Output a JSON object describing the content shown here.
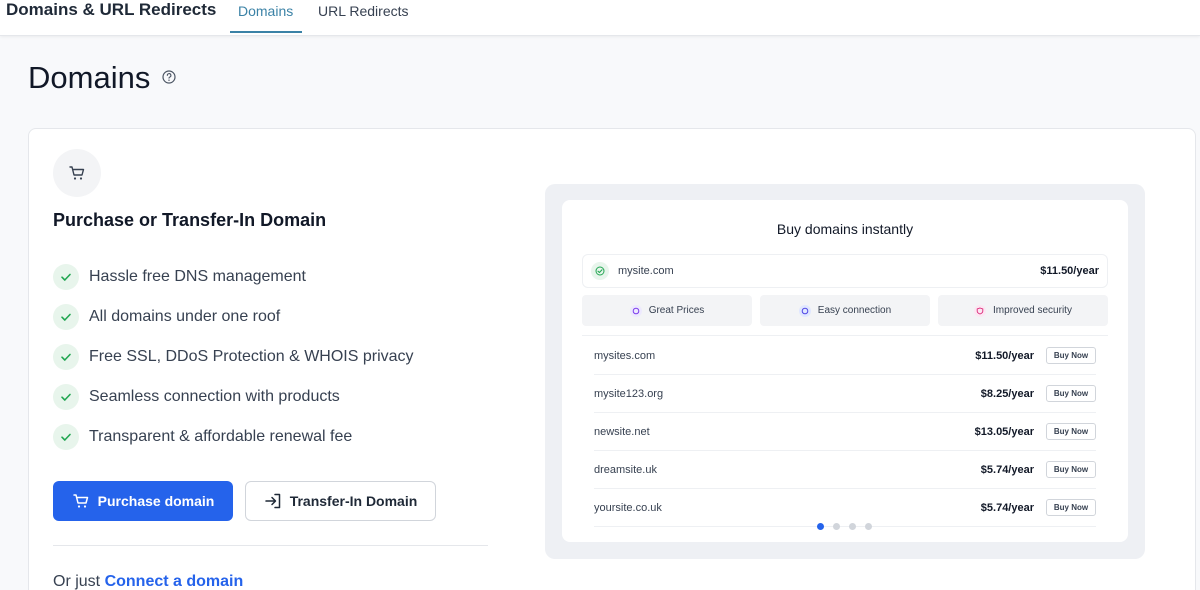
{
  "header": {
    "app_title": "Domains & URL Redirects",
    "tabs": [
      {
        "label": "Domains",
        "active": true
      },
      {
        "label": "URL Redirects",
        "active": false
      }
    ]
  },
  "page": {
    "title": "Domains"
  },
  "purchase": {
    "title": "Purchase or Transfer-In Domain",
    "features": [
      "Hassle free DNS management",
      "All domains under one roof",
      "Free SSL, DDoS Protection & WHOIS privacy",
      "Seamless connection with products",
      "Transparent & affordable renewal fee"
    ],
    "purchase_button": "Purchase domain",
    "transfer_button": "Transfer-In Domain",
    "connect_prefix": "Or just ",
    "connect_link": "Connect a domain"
  },
  "preview": {
    "title": "Buy domains instantly",
    "selected": {
      "domain": "mysite.com",
      "price": "$11.50/year"
    },
    "pills": [
      "Great Prices",
      "Easy connection",
      "Improved security"
    ],
    "buy_label": "Buy Now",
    "rows": [
      {
        "domain": "mysites.com",
        "price": "$11.50/year"
      },
      {
        "domain": "mysite123.org",
        "price": "$8.25/year"
      },
      {
        "domain": "newsite.net",
        "price": "$13.05/year"
      },
      {
        "domain": "dreamsite.uk",
        "price": "$5.74/year"
      },
      {
        "domain": "yoursite.co.uk",
        "price": "$5.74/year"
      }
    ],
    "carousel_active_index": 0,
    "carousel_count": 4
  },
  "colors": {
    "primary": "#2563eb",
    "tab_active": "#3b82a6",
    "check_green": "#22a652"
  }
}
